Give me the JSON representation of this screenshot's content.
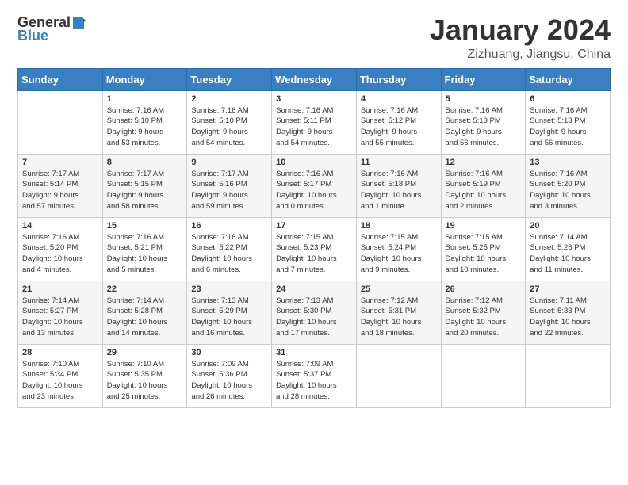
{
  "logo": {
    "general": "General",
    "blue": "Blue"
  },
  "title": "January 2024",
  "subtitle": "Zizhuang, Jiangsu, China",
  "days": [
    "Sunday",
    "Monday",
    "Tuesday",
    "Wednesday",
    "Thursday",
    "Friday",
    "Saturday"
  ],
  "weeks": [
    [
      {
        "day": "",
        "content": ""
      },
      {
        "day": "1",
        "content": "Sunrise: 7:16 AM\nSunset: 5:10 PM\nDaylight: 9 hours\nand 53 minutes."
      },
      {
        "day": "2",
        "content": "Sunrise: 7:16 AM\nSunset: 5:10 PM\nDaylight: 9 hours\nand 54 minutes."
      },
      {
        "day": "3",
        "content": "Sunrise: 7:16 AM\nSunset: 5:11 PM\nDaylight: 9 hours\nand 54 minutes."
      },
      {
        "day": "4",
        "content": "Sunrise: 7:16 AM\nSunset: 5:12 PM\nDaylight: 9 hours\nand 55 minutes."
      },
      {
        "day": "5",
        "content": "Sunrise: 7:16 AM\nSunset: 5:13 PM\nDaylight: 9 hours\nand 56 minutes."
      },
      {
        "day": "6",
        "content": "Sunrise: 7:16 AM\nSunset: 5:13 PM\nDaylight: 9 hours\nand 56 minutes."
      }
    ],
    [
      {
        "day": "7",
        "content": "Sunrise: 7:17 AM\nSunset: 5:14 PM\nDaylight: 9 hours\nand 57 minutes."
      },
      {
        "day": "8",
        "content": "Sunrise: 7:17 AM\nSunset: 5:15 PM\nDaylight: 9 hours\nand 58 minutes."
      },
      {
        "day": "9",
        "content": "Sunrise: 7:17 AM\nSunset: 5:16 PM\nDaylight: 9 hours\nand 59 minutes."
      },
      {
        "day": "10",
        "content": "Sunrise: 7:16 AM\nSunset: 5:17 PM\nDaylight: 10 hours\nand 0 minutes."
      },
      {
        "day": "11",
        "content": "Sunrise: 7:16 AM\nSunset: 5:18 PM\nDaylight: 10 hours\nand 1 minute."
      },
      {
        "day": "12",
        "content": "Sunrise: 7:16 AM\nSunset: 5:19 PM\nDaylight: 10 hours\nand 2 minutes."
      },
      {
        "day": "13",
        "content": "Sunrise: 7:16 AM\nSunset: 5:20 PM\nDaylight: 10 hours\nand 3 minutes."
      }
    ],
    [
      {
        "day": "14",
        "content": "Sunrise: 7:16 AM\nSunset: 5:20 PM\nDaylight: 10 hours\nand 4 minutes."
      },
      {
        "day": "15",
        "content": "Sunrise: 7:16 AM\nSunset: 5:21 PM\nDaylight: 10 hours\nand 5 minutes."
      },
      {
        "day": "16",
        "content": "Sunrise: 7:16 AM\nSunset: 5:22 PM\nDaylight: 10 hours\nand 6 minutes."
      },
      {
        "day": "17",
        "content": "Sunrise: 7:15 AM\nSunset: 5:23 PM\nDaylight: 10 hours\nand 7 minutes."
      },
      {
        "day": "18",
        "content": "Sunrise: 7:15 AM\nSunset: 5:24 PM\nDaylight: 10 hours\nand 9 minutes."
      },
      {
        "day": "19",
        "content": "Sunrise: 7:15 AM\nSunset: 5:25 PM\nDaylight: 10 hours\nand 10 minutes."
      },
      {
        "day": "20",
        "content": "Sunrise: 7:14 AM\nSunset: 5:26 PM\nDaylight: 10 hours\nand 11 minutes."
      }
    ],
    [
      {
        "day": "21",
        "content": "Sunrise: 7:14 AM\nSunset: 5:27 PM\nDaylight: 10 hours\nand 13 minutes."
      },
      {
        "day": "22",
        "content": "Sunrise: 7:14 AM\nSunset: 5:28 PM\nDaylight: 10 hours\nand 14 minutes."
      },
      {
        "day": "23",
        "content": "Sunrise: 7:13 AM\nSunset: 5:29 PM\nDaylight: 10 hours\nand 16 minutes."
      },
      {
        "day": "24",
        "content": "Sunrise: 7:13 AM\nSunset: 5:30 PM\nDaylight: 10 hours\nand 17 minutes."
      },
      {
        "day": "25",
        "content": "Sunrise: 7:12 AM\nSunset: 5:31 PM\nDaylight: 10 hours\nand 18 minutes."
      },
      {
        "day": "26",
        "content": "Sunrise: 7:12 AM\nSunset: 5:32 PM\nDaylight: 10 hours\nand 20 minutes."
      },
      {
        "day": "27",
        "content": "Sunrise: 7:11 AM\nSunset: 5:33 PM\nDaylight: 10 hours\nand 22 minutes."
      }
    ],
    [
      {
        "day": "28",
        "content": "Sunrise: 7:10 AM\nSunset: 5:34 PM\nDaylight: 10 hours\nand 23 minutes."
      },
      {
        "day": "29",
        "content": "Sunrise: 7:10 AM\nSunset: 5:35 PM\nDaylight: 10 hours\nand 25 minutes."
      },
      {
        "day": "30",
        "content": "Sunrise: 7:09 AM\nSunset: 5:36 PM\nDaylight: 10 hours\nand 26 minutes."
      },
      {
        "day": "31",
        "content": "Sunrise: 7:09 AM\nSunset: 5:37 PM\nDaylight: 10 hours\nand 28 minutes."
      },
      {
        "day": "",
        "content": ""
      },
      {
        "day": "",
        "content": ""
      },
      {
        "day": "",
        "content": ""
      }
    ]
  ]
}
